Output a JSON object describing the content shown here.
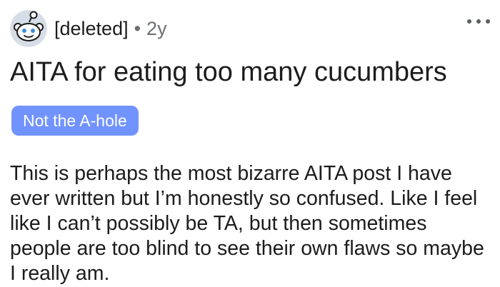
{
  "post": {
    "author": "[deleted]",
    "separator": "•",
    "age": "2y",
    "title": "AITA for eating too many cucumbers",
    "flair": {
      "label": "Not the A-hole",
      "color": "#7193ff"
    },
    "body": "This is perhaps the most bizarre AITA post I have ever written but I’m honestly so confused. Like I feel like I can’t possibly be TA, but then sometimes people are too blind to see their own flaws so maybe I really am."
  },
  "icons": {
    "avatar": "reddit-snoo-avatar",
    "more": "more-options-icon"
  },
  "colors": {
    "avatar_background": "#d6dde6",
    "muted_text": "#6b6f73"
  }
}
